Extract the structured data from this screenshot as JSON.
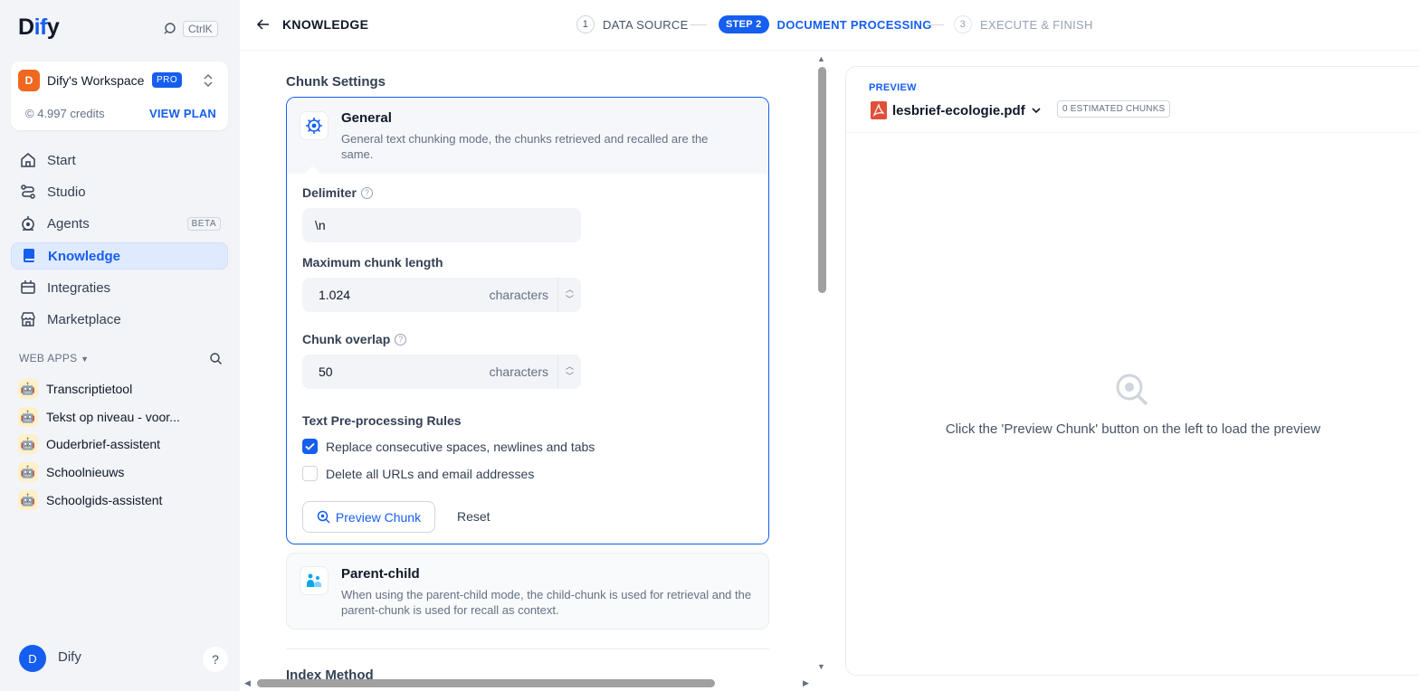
{
  "sidebar": {
    "logo_prefix": "D",
    "logo_highlight": "if",
    "logo_suffix": "y",
    "shortcut": "CtrlK",
    "workspace": {
      "initial": "D",
      "name": "Dify's Workspace",
      "plan_badge": "PRO",
      "credits": "4.997 credits",
      "view_plan": "VIEW PLAN"
    },
    "nav": [
      {
        "label": "Start",
        "icon": "home-icon"
      },
      {
        "label": "Studio",
        "icon": "studio-icon"
      },
      {
        "label": "Agents",
        "icon": "agent-icon",
        "badge": "BETA"
      },
      {
        "label": "Knowledge",
        "icon": "book-icon",
        "active": true
      },
      {
        "label": "Integraties",
        "icon": "integrations-icon"
      },
      {
        "label": "Marketplace",
        "icon": "store-icon"
      }
    ],
    "web_apps_label": "WEB APPS",
    "web_apps": [
      {
        "label": "Transcriptietool"
      },
      {
        "label": "Tekst op niveau - voor..."
      },
      {
        "label": "Ouderbrief-assistent"
      },
      {
        "label": "Schoolnieuws"
      },
      {
        "label": "Schoolgids-assistent"
      }
    ],
    "user": {
      "initial": "D",
      "name": "Dify"
    },
    "help": "?"
  },
  "topbar": {
    "title": "KNOWLEDGE",
    "steps": [
      {
        "num": "1",
        "label": "DATA SOURCE",
        "state": "done"
      },
      {
        "num": "STEP 2",
        "label": "DOCUMENT PROCESSING",
        "state": "active"
      },
      {
        "num": "3",
        "label": "EXECUTE & FINISH",
        "state": "pending"
      }
    ]
  },
  "chunk_settings": {
    "title": "Chunk Settings",
    "general": {
      "title": "General",
      "description": "General text chunking mode, the chunks retrieved and recalled are the same."
    },
    "delimiter_label": "Delimiter",
    "delimiter_value": "\\n",
    "max_length_label": "Maximum chunk length",
    "max_length_value": "1.024",
    "overlap_label": "Chunk overlap",
    "overlap_value": "50",
    "unit": "characters",
    "rules_label": "Text Pre-processing Rules",
    "rules": [
      {
        "label": "Replace consecutive spaces, newlines and tabs",
        "checked": true
      },
      {
        "label": "Delete all URLs and email addresses",
        "checked": false
      }
    ],
    "preview_button": "Preview Chunk",
    "reset_button": "Reset",
    "parent_child": {
      "title": "Parent-child",
      "description": "When using the parent-child mode, the child-chunk is used for retrieval and the parent-chunk is used for recall as context."
    },
    "index_method_label": "Index Method"
  },
  "preview": {
    "label": "PREVIEW",
    "file_name": "lesbrief-ecologie.pdf",
    "chunks_badge": "0 ESTIMATED CHUNKS",
    "empty_text": "Click the 'Preview Chunk' button on the left to load the preview"
  },
  "colors": {
    "accent": "#155eef",
    "workspace_avatar": "#ef6820",
    "pdf_icon": "#e04f39"
  }
}
